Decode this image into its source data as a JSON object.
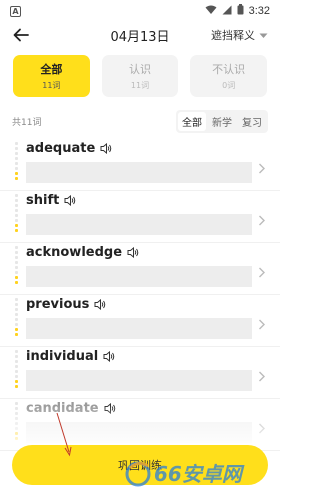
{
  "status": {
    "app_icon_letter": "A",
    "time": "3:32"
  },
  "header": {
    "title": "04月13日",
    "right_label": "遮挡释义"
  },
  "filters": [
    {
      "label": "全部",
      "count": "11词",
      "active": true
    },
    {
      "label": "认识",
      "count": "11词",
      "active": false
    },
    {
      "label": "不认识",
      "count": "0词",
      "active": false
    }
  ],
  "summary": {
    "total": "共11词",
    "tabs": [
      "全部",
      "新学",
      "复习"
    ],
    "active_tab": "全部"
  },
  "words": [
    {
      "word": "adequate",
      "level": [
        false,
        false,
        false,
        false,
        false,
        false,
        true,
        true
      ]
    },
    {
      "word": "shift",
      "level": [
        false,
        false,
        false,
        false,
        false,
        false,
        true,
        true
      ]
    },
    {
      "word": "acknowledge",
      "level": [
        false,
        false,
        false,
        false,
        false,
        false,
        true,
        true
      ]
    },
    {
      "word": "previous",
      "level": [
        false,
        false,
        false,
        false,
        false,
        false,
        true,
        true
      ]
    },
    {
      "word": "individual",
      "level": [
        false,
        false,
        false,
        false,
        false,
        false,
        true,
        true
      ]
    },
    {
      "word": "candidate",
      "level": [
        false,
        false,
        false,
        false,
        false,
        false,
        true,
        true
      ]
    }
  ],
  "cta": {
    "label": "巩固训练"
  },
  "watermark": {
    "text": "66安卓网"
  },
  "colors": {
    "accent": "#ffdf1b",
    "level_dot": "#ffd21f"
  }
}
